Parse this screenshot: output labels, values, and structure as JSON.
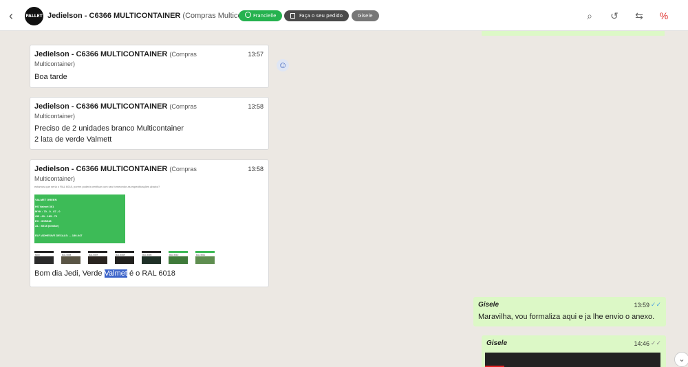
{
  "header": {
    "back_icon": "chevron-left-icon",
    "avatar_text": "PALLET",
    "contact_name": "Jedielson - C6366 MULTICONTAINER",
    "contact_company": "(Compras Multicontainer)",
    "pill_green": "Francielle",
    "pill_order": "Faça o seu pedido",
    "pill_agent": "Gisele",
    "icons": [
      "search-icon",
      "history-icon",
      "transfer-icon",
      "percent-icon"
    ]
  },
  "messages": [
    {
      "name": "Jedielson - C6366 MULTICONTAINER",
      "company_line1": "(Compras",
      "company_line2": "Multicontainer)",
      "time": "13:57",
      "text": "Boa tarde"
    },
    {
      "name": "Jedielson - C6366 MULTICONTAINER",
      "company_line1": "(Compras",
      "company_line2": "Multicontainer)",
      "time": "13:58",
      "text_line1": "Preciso de 2 unidades branco Multicontainer",
      "text_line2": "2 lata de verde Valmett"
    },
    {
      "name": "Jedielson - C6366 MULTICONTAINER",
      "company_line1": "(Compras",
      "company_line2": "Multicontainer)",
      "time": "13:58",
      "image_caption": "estamos que seria o RAL 6018, porém poderia verificar com seu fornecedor as especificações abaixo?",
      "green_title": "VALMET GREEN",
      "green_rows": [
        "HS    Valmet  361",
        "MYK   : 70 - 0 - 87 - 0",
        "GB    : 60 - 185 - 72",
        "EX    : 3CB948",
        "AL    : 6018 (similar)",
        "ELF-ADHESIVE DECALS: ... 180-047"
      ],
      "swatches": [
        {
          "label": "6003",
          "color": "#2b2b2b"
        },
        {
          "label": "RAL 6006",
          "color": "#5a5545"
        },
        {
          "label": "RAL 6007",
          "color": "#2a2520"
        },
        {
          "label": "RAL 6008",
          "color": "#22211e"
        },
        {
          "label": "RAL 6009",
          "color": "#1f3027"
        },
        {
          "label": "RAL 6010",
          "color": "#3f7a3a"
        },
        {
          "label": "RAL 6011",
          "color": "#5f8e50"
        }
      ],
      "text_before": "Bom dia Jedi, Verde ",
      "text_highlight": "Valmet",
      "text_after": "é o RAL 6018"
    }
  ],
  "outgoing": [
    {
      "author": "Gisele",
      "time": "13:59",
      "text": "Maravilha, vou formaliza aqui e ja lhe envio o anexo."
    },
    {
      "author": "Gisele",
      "time": "14:46"
    }
  ],
  "colors": {
    "accent_green": "#25b24f",
    "bubble_out": "#dcf8c6",
    "chat_bg": "#ece8e3",
    "highlight": "#3b63c9"
  }
}
